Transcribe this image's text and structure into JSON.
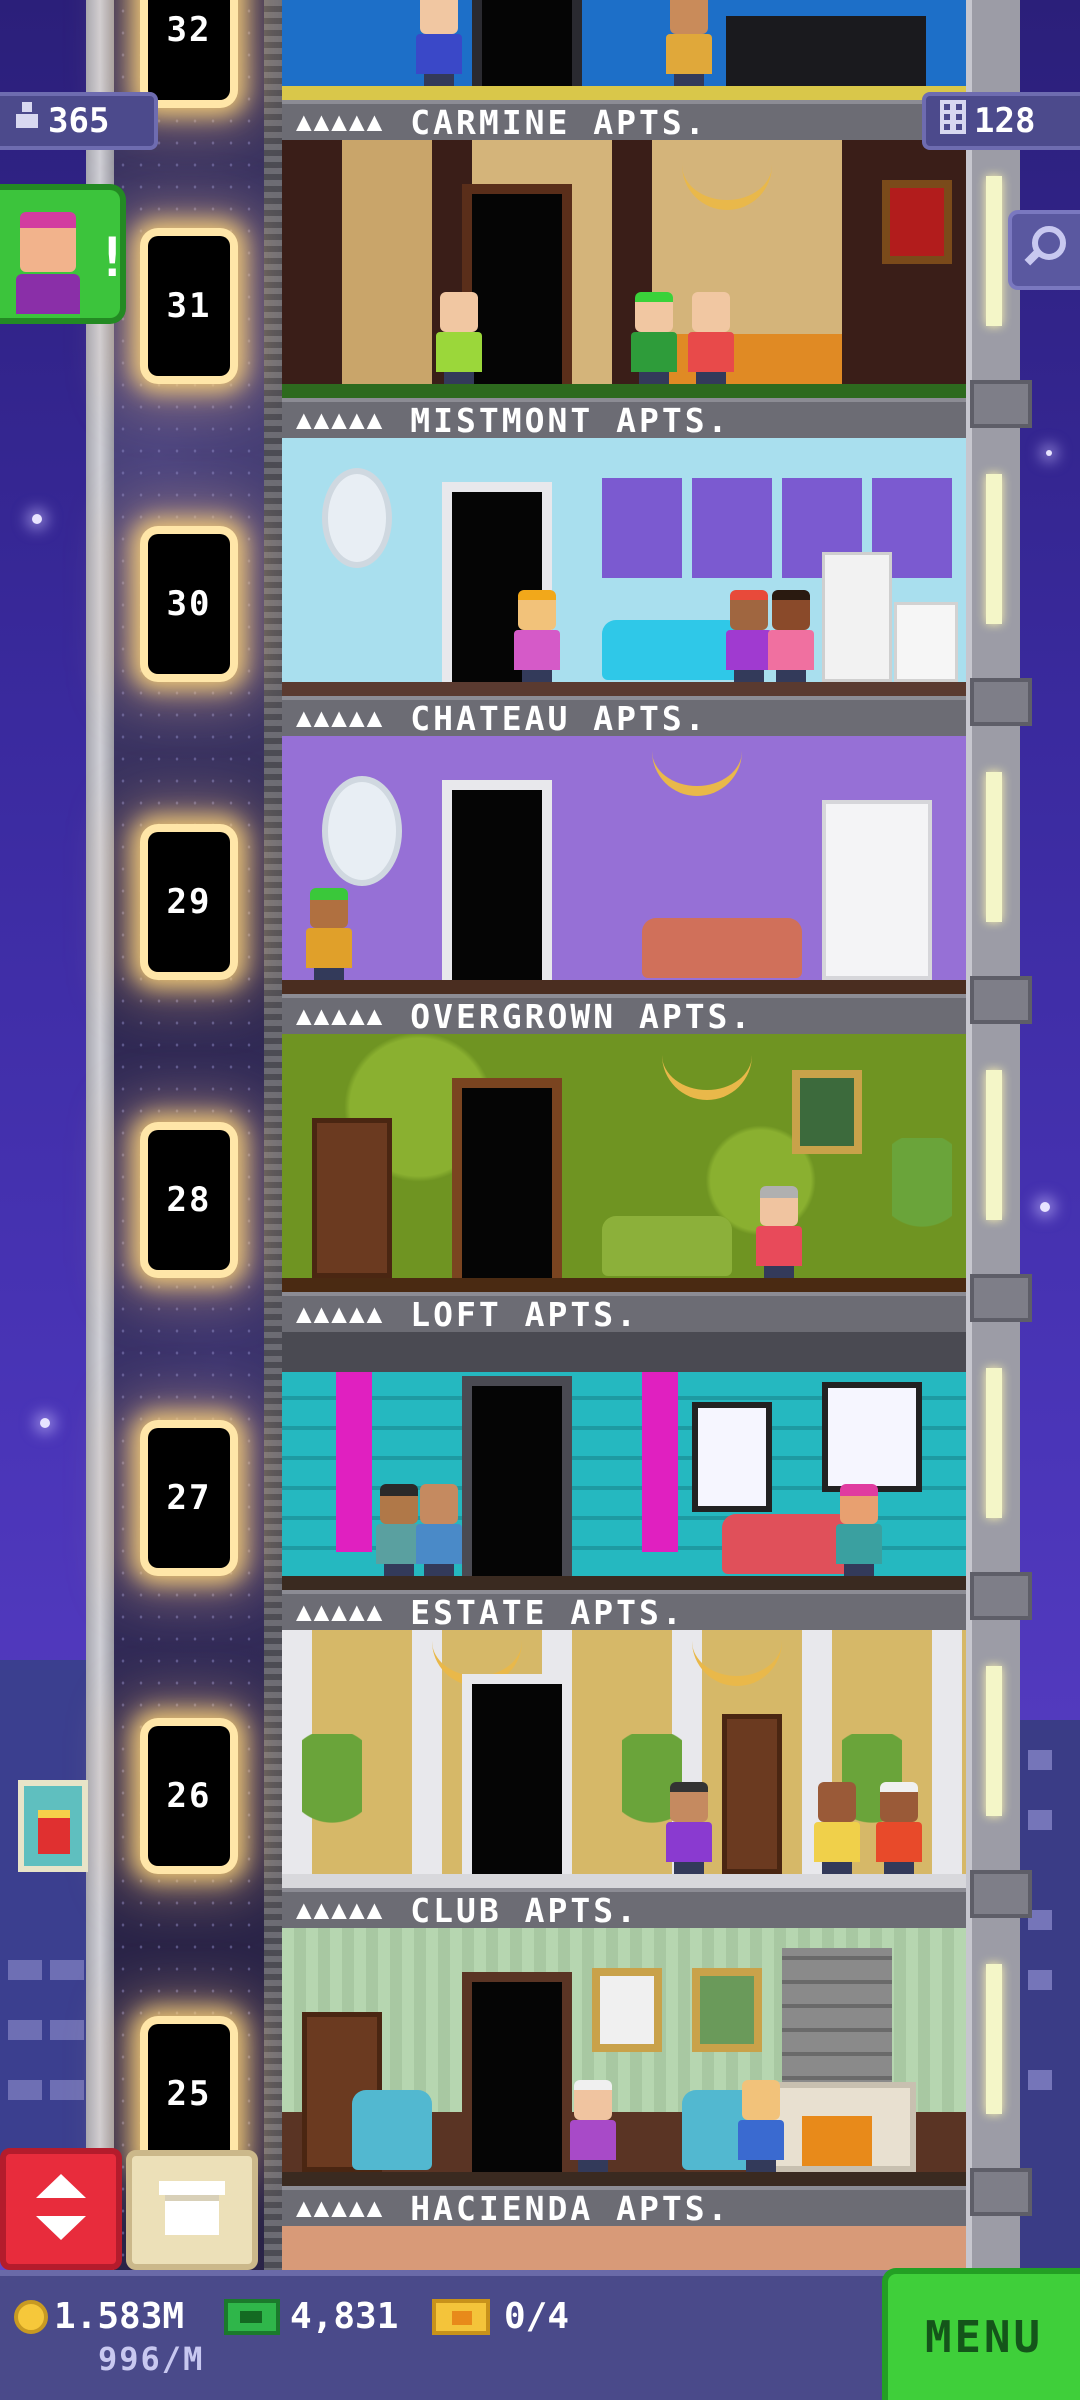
{
  "hud": {
    "population": "365",
    "floor_count": "128",
    "coins": "1.583M",
    "coin_rate": "996/M",
    "bux": "4,831",
    "tickets": "0/4",
    "menu_label": "MENU"
  },
  "floors": [
    {
      "number": "32",
      "name": "CARMINE APTS.",
      "stars": "▲▲▲▲▲"
    },
    {
      "number": "31",
      "name": "MISTMONT APTS.",
      "stars": "▲▲▲▲▲"
    },
    {
      "number": "30",
      "name": "CHATEAU APTS.",
      "stars": "▲▲▲▲▲"
    },
    {
      "number": "29",
      "name": "OVERGROWN APTS.",
      "stars": "▲▲▲▲▲"
    },
    {
      "number": "28",
      "name": "LOFT APTS.",
      "stars": "▲▲▲▲▲"
    },
    {
      "number": "27",
      "name": "ESTATE APTS.",
      "stars": "▲▲▲▲▲"
    },
    {
      "number": "26",
      "name": "CLUB APTS.",
      "stars": "▲▲▲▲▲"
    },
    {
      "number": "25",
      "name": "HACIENDA APTS.",
      "stars": "▲▲▲▲▲"
    }
  ],
  "icons": {
    "population": "person-icon",
    "floors": "building-icon",
    "search": "magnifier-icon",
    "notification": "bitizen-alert-icon",
    "elevator": "up-down-arrows-icon",
    "crate": "crate-icon",
    "coins": "coin-icon",
    "bux": "tower-bux-icon",
    "tickets": "golden-ticket-icon"
  },
  "colors": {
    "accent_green": "#3fcf3a",
    "elevator_red": "#e82c3c",
    "sky": "#3a2a9e",
    "coin": "#f6c83a"
  }
}
